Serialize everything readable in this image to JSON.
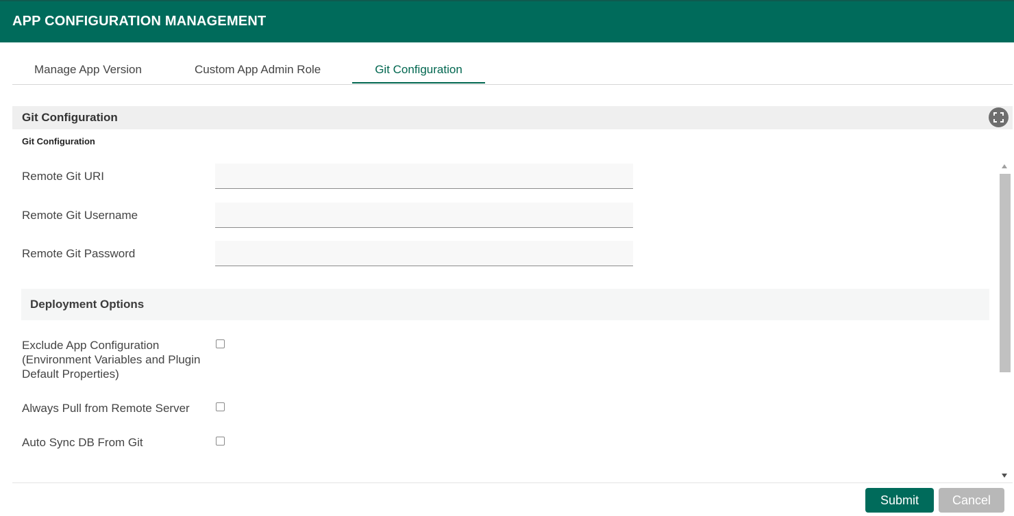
{
  "header": {
    "title": "APP CONFIGURATION MANAGEMENT"
  },
  "tabs": [
    {
      "label": "Manage App Version",
      "active": false
    },
    {
      "label": "Custom App Admin Role",
      "active": false
    },
    {
      "label": "Git Configuration",
      "active": true
    }
  ],
  "panel": {
    "title": "Git Configuration",
    "subtitle": "Git Configuration",
    "fullscreen_icon": "fullscreen-icon"
  },
  "fields": [
    {
      "label": "Remote Git URI",
      "value": ""
    },
    {
      "label": "Remote Git Username",
      "value": ""
    },
    {
      "label": "Remote Git Password",
      "value": ""
    }
  ],
  "deployment": {
    "title": "Deployment Options",
    "options": [
      {
        "label": "Exclude App Configuration (Environment Variables and Plugin Default Properties)",
        "checked": false
      },
      {
        "label": "Always Pull from Remote Server",
        "checked": false
      },
      {
        "label": "Auto Sync DB From Git",
        "checked": false
      }
    ]
  },
  "footer": {
    "submit_label": "Submit",
    "cancel_label": "Cancel"
  },
  "colors": {
    "brand": "#006b5b",
    "cancel": "#b8b8b8"
  }
}
